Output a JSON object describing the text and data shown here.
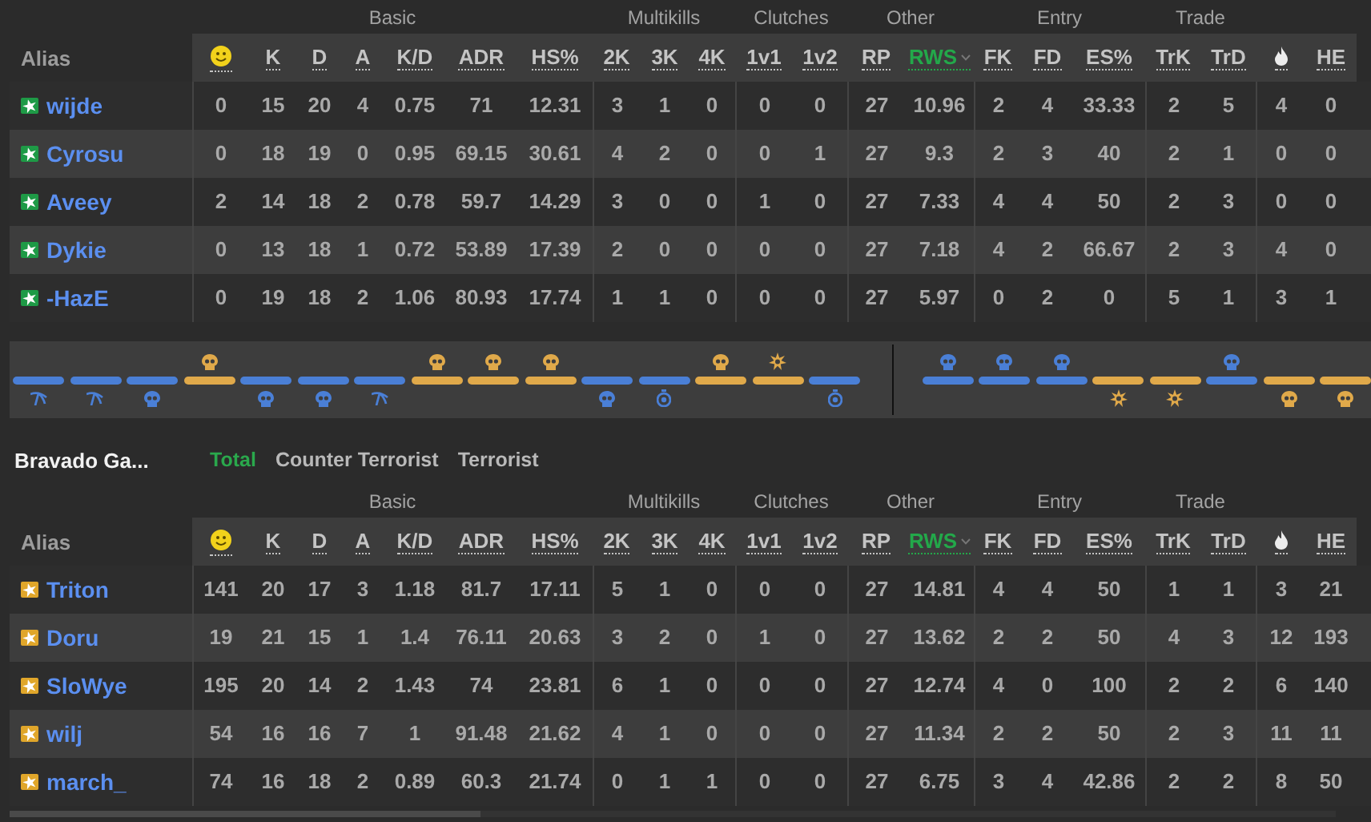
{
  "scoreboard_1": {
    "color": "#1e9a46",
    "alias_heading": "Alias",
    "column_groups": [
      {
        "label": "Basic",
        "columns": [
          {
            "kind": "smiley",
            "selected": false
          },
          {
            "kind": "text",
            "label": "K",
            "selected": false
          },
          {
            "kind": "text",
            "label": "D",
            "selected": false
          },
          {
            "kind": "text",
            "label": "A",
            "selected": false
          },
          {
            "kind": "text",
            "label": "K/D",
            "selected": false
          },
          {
            "kind": "text",
            "label": "ADR",
            "selected": false
          },
          {
            "kind": "text",
            "label": "HS%",
            "selected": false
          }
        ]
      },
      {
        "label": "Multikills",
        "columns": [
          {
            "kind": "text",
            "label": "2K",
            "selected": false
          },
          {
            "kind": "text",
            "label": "3K",
            "selected": false
          },
          {
            "kind": "text",
            "label": "4K",
            "selected": false
          }
        ]
      },
      {
        "label": "Clutches",
        "columns": [
          {
            "kind": "text",
            "label": "1v1",
            "selected": false
          },
          {
            "kind": "text",
            "label": "1v2",
            "selected": false
          }
        ]
      },
      {
        "label": "Other",
        "columns": [
          {
            "kind": "text",
            "label": "RP",
            "selected": false
          },
          {
            "kind": "text",
            "label": "RWS",
            "selected": true
          }
        ]
      },
      {
        "label": "Entry",
        "columns": [
          {
            "kind": "text",
            "label": "FK",
            "selected": false
          },
          {
            "kind": "text",
            "label": "FD",
            "selected": false
          },
          {
            "kind": "text",
            "label": "ES%",
            "selected": false
          }
        ]
      },
      {
        "label": "Trade",
        "columns": [
          {
            "kind": "text",
            "label": "TrK",
            "selected": false
          },
          {
            "kind": "text",
            "label": "TrD",
            "selected": false
          }
        ]
      },
      {
        "columns": [
          {
            "kind": "flame",
            "selected": false
          },
          {
            "kind": "text",
            "label": "HE",
            "selected": false
          }
        ]
      }
    ],
    "rows": [
      {
        "alias": "wijde",
        "cells": [
          "0",
          "15",
          "20",
          "4",
          "0.75",
          "71",
          "12.31",
          "3",
          "1",
          "0",
          "0",
          "0",
          "27",
          "10.96",
          "2",
          "4",
          "33.33",
          "2",
          "5",
          "4",
          "0"
        ]
      },
      {
        "alias": "Cyrosu",
        "cells": [
          "0",
          "18",
          "19",
          "0",
          "0.95",
          "69.15",
          "30.61",
          "4",
          "2",
          "0",
          "0",
          "1",
          "27",
          "9.3",
          "2",
          "3",
          "40",
          "2",
          "1",
          "0",
          "0"
        ]
      },
      {
        "alias": "Aveey",
        "cells": [
          "2",
          "14",
          "18",
          "2",
          "0.78",
          "59.7",
          "14.29",
          "3",
          "0",
          "0",
          "1",
          "0",
          "27",
          "7.33",
          "4",
          "4",
          "50",
          "2",
          "3",
          "0",
          "0"
        ]
      },
      {
        "alias": "Dykie",
        "cells": [
          "0",
          "13",
          "18",
          "1",
          "0.72",
          "53.89",
          "17.39",
          "2",
          "0",
          "0",
          "0",
          "0",
          "27",
          "7.18",
          "4",
          "2",
          "66.67",
          "2",
          "3",
          "4",
          "0"
        ]
      },
      {
        "alias": "-HazE",
        "cells": [
          "0",
          "19",
          "18",
          "2",
          "1.06",
          "80.93",
          "17.74",
          "1",
          "1",
          "0",
          "0",
          "0",
          "27",
          "5.97",
          "0",
          "2",
          "0",
          "5",
          "1",
          "3",
          "1"
        ]
      }
    ]
  },
  "timeline": {
    "halves": [
      {
        "rounds": [
          {
            "color": "#4a7fd6",
            "kind": "defuse",
            "upper": false
          },
          {
            "color": "#4a7fd6",
            "kind": "defuse",
            "upper": false
          },
          {
            "color": "#4a7fd6",
            "kind": "elimination",
            "upper": false
          },
          {
            "color": "#e0a94a",
            "kind": "elimination",
            "upper": true
          },
          {
            "color": "#4a7fd6",
            "kind": "elimination",
            "upper": false
          },
          {
            "color": "#4a7fd6",
            "kind": "elimination",
            "upper": false
          },
          {
            "color": "#4a7fd6",
            "kind": "defuse",
            "upper": false
          },
          {
            "color": "#e0a94a",
            "kind": "elimination",
            "upper": true
          },
          {
            "color": "#e0a94a",
            "kind": "elimination",
            "upper": true
          },
          {
            "color": "#e0a94a",
            "kind": "elimination",
            "upper": true
          },
          {
            "color": "#4a7fd6",
            "kind": "elimination",
            "upper": false
          },
          {
            "color": "#4a7fd6",
            "kind": "time",
            "upper": false
          },
          {
            "color": "#e0a94a",
            "kind": "elimination",
            "upper": true
          },
          {
            "color": "#e0a94a",
            "kind": "explosion",
            "upper": true
          },
          {
            "color": "#4a7fd6",
            "kind": "time",
            "upper": false
          }
        ]
      },
      {
        "rounds": [
          {
            "color": "#4a7fd6",
            "kind": "elimination",
            "upper": true
          },
          {
            "color": "#4a7fd6",
            "kind": "elimination",
            "upper": true
          },
          {
            "color": "#4a7fd6",
            "kind": "elimination",
            "upper": true
          },
          {
            "color": "#e0a94a",
            "kind": "explosion",
            "upper": false
          },
          {
            "color": "#e0a94a",
            "kind": "explosion",
            "upper": false
          },
          {
            "color": "#4a7fd6",
            "kind": "elimination",
            "upper": true
          },
          {
            "color": "#e0a94a",
            "kind": "elimination",
            "upper": false
          },
          {
            "color": "#e0a94a",
            "kind": "elimination",
            "upper": false
          }
        ]
      }
    ]
  },
  "team_tabs": {
    "title": "Bravado Ga...",
    "tabs": [
      {
        "label": "Total",
        "selected": true
      },
      {
        "label": "Counter Terrorist",
        "selected": false
      },
      {
        "label": "Terrorist",
        "selected": false
      }
    ]
  },
  "scoreboard_2": {
    "color": "#e0a62a",
    "alias_heading": "Alias",
    "column_groups": [
      {
        "label": "Basic",
        "columns": [
          {
            "kind": "smiley",
            "selected": false
          },
          {
            "kind": "text",
            "label": "K",
            "selected": false
          },
          {
            "kind": "text",
            "label": "D",
            "selected": false
          },
          {
            "kind": "text",
            "label": "A",
            "selected": false
          },
          {
            "kind": "text",
            "label": "K/D",
            "selected": false
          },
          {
            "kind": "text",
            "label": "ADR",
            "selected": false
          },
          {
            "kind": "text",
            "label": "HS%",
            "selected": false
          }
        ]
      },
      {
        "label": "Multikills",
        "columns": [
          {
            "kind": "text",
            "label": "2K",
            "selected": false
          },
          {
            "kind": "text",
            "label": "3K",
            "selected": false
          },
          {
            "kind": "text",
            "label": "4K",
            "selected": false
          }
        ]
      },
      {
        "label": "Clutches",
        "columns": [
          {
            "kind": "text",
            "label": "1v1",
            "selected": false
          },
          {
            "kind": "text",
            "label": "1v2",
            "selected": false
          }
        ]
      },
      {
        "label": "Other",
        "columns": [
          {
            "kind": "text",
            "label": "RP",
            "selected": false
          },
          {
            "kind": "text",
            "label": "RWS",
            "selected": true
          }
        ]
      },
      {
        "label": "Entry",
        "columns": [
          {
            "kind": "text",
            "label": "FK",
            "selected": false
          },
          {
            "kind": "text",
            "label": "FD",
            "selected": false
          },
          {
            "kind": "text",
            "label": "ES%",
            "selected": false
          }
        ]
      },
      {
        "label": "Trade",
        "columns": [
          {
            "kind": "text",
            "label": "TrK",
            "selected": false
          },
          {
            "kind": "text",
            "label": "TrD",
            "selected": false
          }
        ]
      },
      {
        "columns": [
          {
            "kind": "flame",
            "selected": false
          },
          {
            "kind": "text",
            "label": "HE",
            "selected": false
          }
        ]
      }
    ],
    "rows": [
      {
        "alias": "Triton",
        "cells": [
          "141",
          "20",
          "17",
          "3",
          "1.18",
          "81.7",
          "17.11",
          "5",
          "1",
          "0",
          "0",
          "0",
          "27",
          "14.81",
          "4",
          "4",
          "50",
          "1",
          "1",
          "3",
          "21"
        ]
      },
      {
        "alias": "Doru",
        "cells": [
          "19",
          "21",
          "15",
          "1",
          "1.4",
          "76.11",
          "20.63",
          "3",
          "2",
          "0",
          "1",
          "0",
          "27",
          "13.62",
          "2",
          "2",
          "50",
          "4",
          "3",
          "12",
          "193"
        ]
      },
      {
        "alias": "SloWye",
        "cells": [
          "195",
          "20",
          "14",
          "2",
          "1.43",
          "74",
          "23.81",
          "6",
          "1",
          "0",
          "0",
          "0",
          "27",
          "12.74",
          "4",
          "0",
          "100",
          "2",
          "2",
          "6",
          "140"
        ]
      },
      {
        "alias": "wilj",
        "cells": [
          "54",
          "16",
          "16",
          "7",
          "1",
          "91.48",
          "21.62",
          "4",
          "1",
          "0",
          "0",
          "0",
          "27",
          "11.34",
          "2",
          "2",
          "50",
          "2",
          "3",
          "11",
          "11"
        ]
      },
      {
        "alias": "march_",
        "cells": [
          "74",
          "16",
          "18",
          "2",
          "0.89",
          "60.3",
          "21.74",
          "0",
          "1",
          "1",
          "0",
          "0",
          "27",
          "6.75",
          "3",
          "4",
          "42.86",
          "2",
          "2",
          "8",
          "50"
        ]
      }
    ]
  }
}
